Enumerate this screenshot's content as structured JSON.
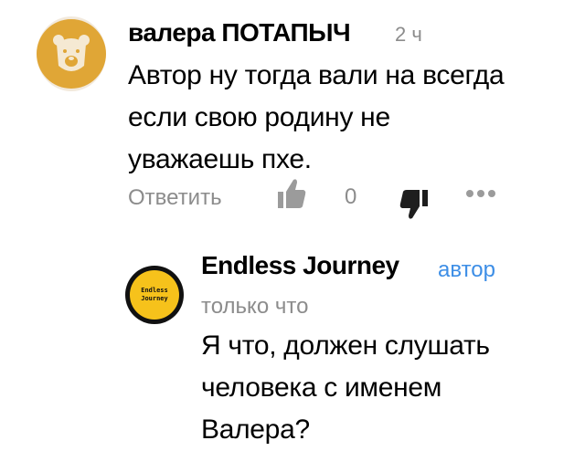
{
  "comment": {
    "author": "валера ПОТАПЫЧ",
    "time": "2 ч",
    "text_lines": [
      "Автор ну тогда вали на всегда",
      "если свою родину не",
      "уважаешь пхе."
    ],
    "avatar_icon": "bear-icon",
    "avatar_color": "#e0a636",
    "actions": {
      "reply_label": "Ответить",
      "like_icon": "thumbs-up-icon",
      "rating": "0",
      "dislike_icon": "thumbs-down-icon",
      "more_icon": "more-dots-icon"
    }
  },
  "reply": {
    "author": "Endless Journey",
    "author_badge": "автор",
    "time": "только что",
    "avatar_text_lines": [
      "Endless",
      "Journey"
    ],
    "avatar_color": "#f6c21b",
    "text_lines": [
      "Я что, должен слушать",
      "человека с именем",
      "Валера?"
    ]
  },
  "colors": {
    "muted": "#8c8c8c",
    "link": "#3d8ee6"
  }
}
